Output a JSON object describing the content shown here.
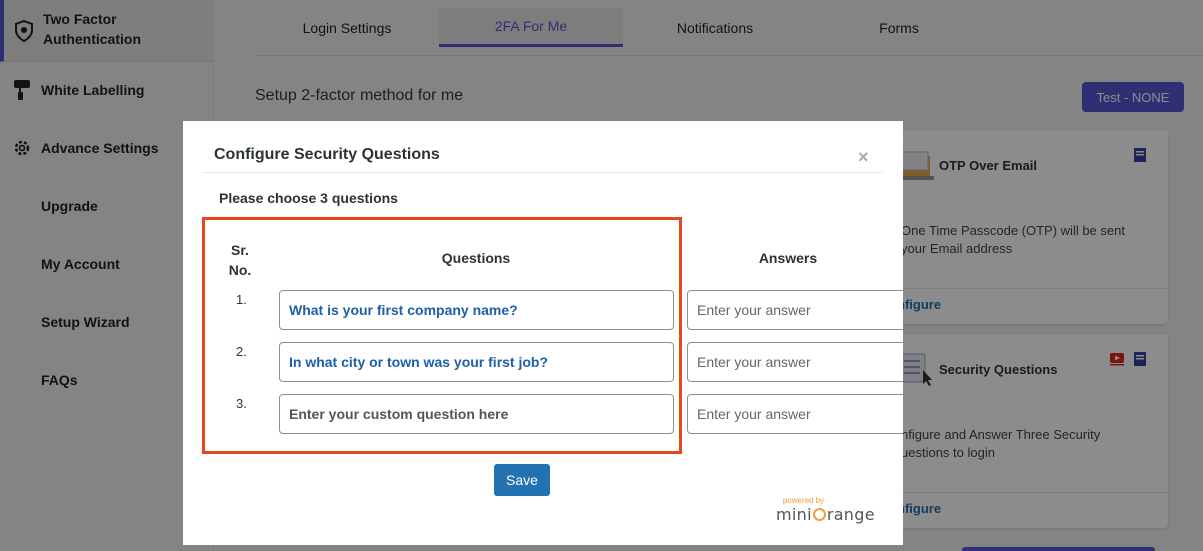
{
  "sidebar": {
    "items": [
      {
        "label_line1": "Two Factor",
        "label_line2": "Authentication",
        "icon": "shield-icon"
      },
      {
        "label": "White Labelling",
        "icon": "paint-roller-icon"
      },
      {
        "label": "Advance Settings",
        "icon": "gear-icon"
      },
      {
        "label": "Upgrade"
      },
      {
        "label": "My Account"
      },
      {
        "label": "Setup Wizard"
      },
      {
        "label": "FAQs"
      }
    ]
  },
  "tabs": [
    {
      "label": "Login Settings"
    },
    {
      "label": "2FA For Me",
      "active": true
    },
    {
      "label": "Notifications"
    },
    {
      "label": "Forms"
    }
  ],
  "main": {
    "setup_title": "Setup 2-factor method for me",
    "test_button": "Test - NONE"
  },
  "cards": {
    "otp_email": {
      "title": "OTP Over Email",
      "desc_line1": "One Time Passcode (OTP) will be sent",
      "desc_line2": "your Email address",
      "link": "nfigure"
    },
    "security_questions": {
      "title": "Security Questions",
      "desc_line1": "nfigure and Answer Three Security",
      "desc_line2": "uestions to login",
      "link": "nfigure"
    }
  },
  "modal": {
    "title": "Configure Security Questions",
    "close": "×",
    "subtitle": "Please choose 3 questions",
    "headers": {
      "sr_line1": "Sr.",
      "sr_line2": "No.",
      "questions": "Questions",
      "answers": "Answers"
    },
    "rows": [
      {
        "num": "1.",
        "question": "What is your first company name?",
        "answer_placeholder": "Enter your answer"
      },
      {
        "num": "2.",
        "question": "In what city or town was your first job?",
        "answer_placeholder": "Enter your answer"
      },
      {
        "num": "3.",
        "question": "Enter your custom question here",
        "answer_placeholder": "Enter your answer"
      }
    ],
    "save_button": "Save",
    "logo_powered": "powered by",
    "logo_text_a": "mini",
    "logo_text_b": "range"
  },
  "colors": {
    "accent": "#5a57d4",
    "link": "#2271b1",
    "highlight": "#e8471c",
    "logo_orange": "#f39c3c"
  }
}
